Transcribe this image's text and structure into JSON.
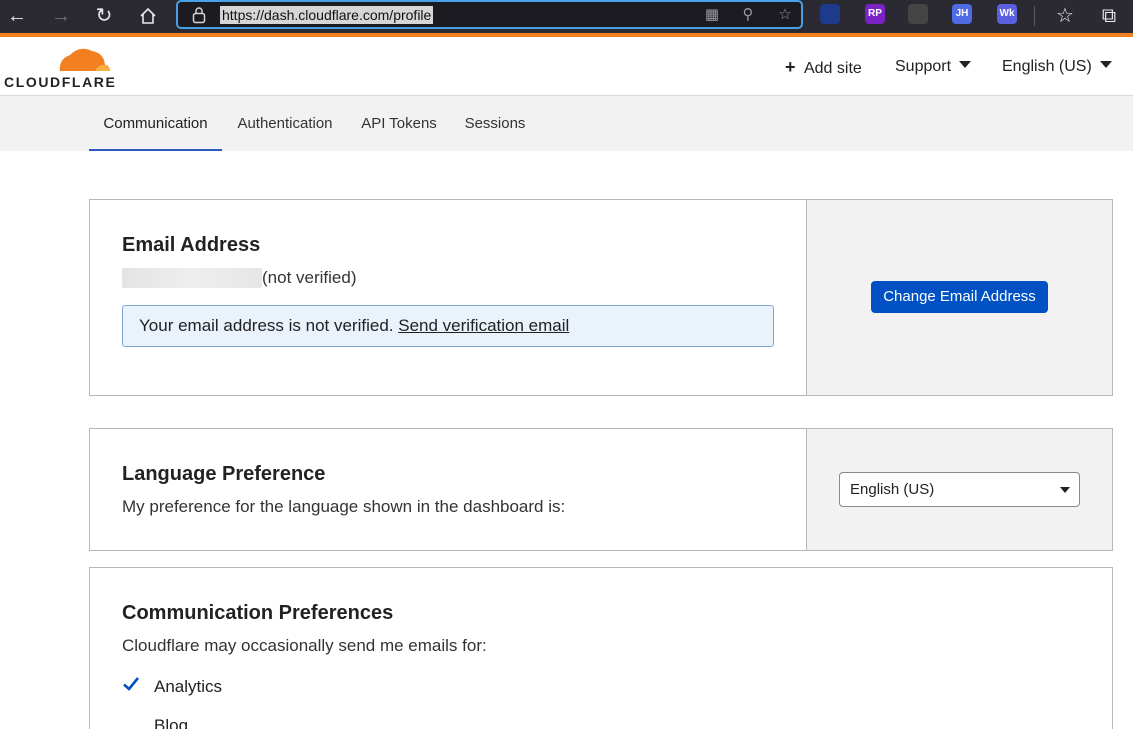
{
  "browser": {
    "url": "https://dash.cloudflare.com/profile",
    "extensions": [
      {
        "icon": "react-devtools-icon",
        "label": "",
        "color": "#1e3a8a"
      },
      {
        "icon": "extension-rp-icon",
        "label": "RP",
        "color": "#7b22c6"
      },
      {
        "icon": "qr-code-icon",
        "label": "",
        "color": "#444444"
      },
      {
        "icon": "extension-jh-icon",
        "label": "JH",
        "color": "#4f6be6"
      },
      {
        "icon": "extension-wk-icon",
        "label": "Wk",
        "color": "#5b5fe0"
      }
    ]
  },
  "header": {
    "logo_text": "CLOUDFLARE",
    "add_site": "Add site",
    "support": "Support",
    "language": "English (US)"
  },
  "tabs": [
    {
      "label": "Communication",
      "active": true
    },
    {
      "label": "Authentication",
      "active": false
    },
    {
      "label": "API Tokens",
      "active": false
    },
    {
      "label": "Sessions",
      "active": false
    }
  ],
  "email_card": {
    "title": "Email Address",
    "status": "(not verified)",
    "notice_text": "Your email address is not verified.",
    "notice_link": "Send verification email",
    "button": "Change Email Address"
  },
  "language_card": {
    "title": "Language Preference",
    "description": "My preference for the language shown in the dashboard is:",
    "selected": "English (US)"
  },
  "communication_card": {
    "title": "Communication Preferences",
    "description": "Cloudflare may occasionally send me emails for:",
    "items": [
      {
        "label": "Analytics",
        "checked": true
      },
      {
        "label": "Blog",
        "checked": false
      }
    ]
  },
  "colors": {
    "brand_orange": "#f38020",
    "primary_blue": "#0051c3",
    "tab_active": "#2c5bc2"
  }
}
